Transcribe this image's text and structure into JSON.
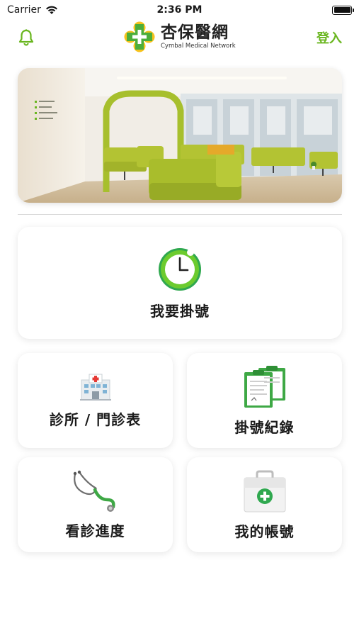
{
  "status": {
    "carrier": "Carrier",
    "time": "2:36 PM"
  },
  "header": {
    "app_title": "杏保醫網",
    "app_subtitle": "Cymbal Medical Network",
    "login_label": "登入",
    "bell_icon": "bell-icon",
    "accent_color": "#6ab620"
  },
  "menu": {
    "register": {
      "label": "我要掛號",
      "icon": "clock-icon"
    },
    "clinics": {
      "label": "診所 / 門診表",
      "icon": "hospital-icon"
    },
    "records": {
      "label": "掛號紀錄",
      "icon": "clipboard-icon"
    },
    "progress": {
      "label": "看診進度",
      "icon": "stethoscope-icon"
    },
    "account": {
      "label": "我的帳號",
      "icon": "medical-bag-icon"
    }
  }
}
